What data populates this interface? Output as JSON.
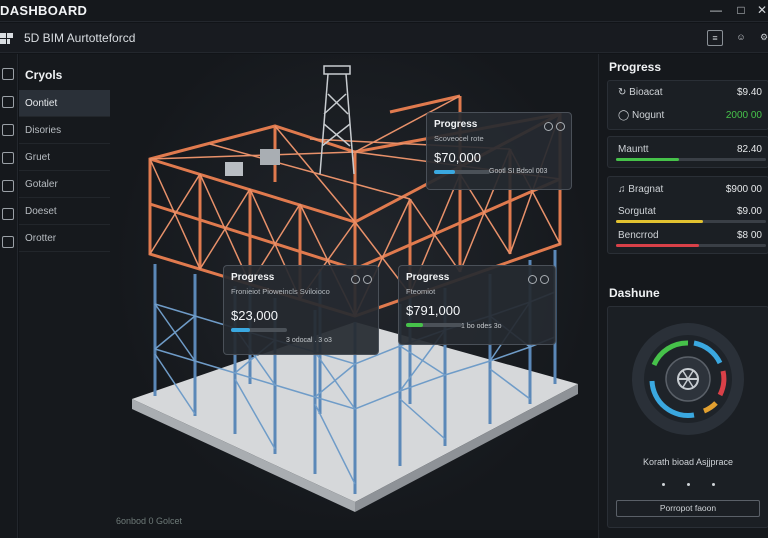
{
  "window": {
    "title": "DASHBOARD"
  },
  "app": {
    "title": "5D BIM Aurtotteforcd"
  },
  "sidebar": {
    "heading": "Cryols",
    "items": [
      {
        "label": "Oontiet",
        "active": true
      },
      {
        "label": "Disories"
      },
      {
        "label": "Gruet"
      },
      {
        "label": "Gotaler"
      },
      {
        "label": "Doeset"
      },
      {
        "label": "Orotter"
      }
    ]
  },
  "viewport": {
    "status": "6onbod 0 Golcet",
    "cards": [
      {
        "title": "Progress",
        "subtitle": "Scoveocel rote",
        "value": "$70,000",
        "progress": 0.38,
        "bar_color": "#3aa8e0",
        "bar_text": "Gootl   SI Bdsol 003"
      },
      {
        "title": "Progress",
        "subtitle": "Fronieiot  Pioweincls Sviloioco",
        "value": "$23,000",
        "progress": 0.34,
        "bar_color": "#3aa8e0",
        "bar_text": "3   odocal .   3 o3"
      },
      {
        "title": "Progress",
        "subtitle": "Fteomiot",
        "value": "$791,000",
        "progress": 0.3,
        "bar_color": "#46c24a",
        "bar_text": "1  bo  odes 3o"
      }
    ]
  },
  "progress_panel": {
    "heading": "Progress",
    "rows": [
      {
        "icon": "refresh-icon",
        "label": "Bioacat",
        "value": "$9.40"
      },
      {
        "icon": "chat-icon",
        "label": "Nogunt",
        "value": "2000 00",
        "value_color": "#46c24a"
      },
      {
        "label": "Mauntt",
        "value": "82.40",
        "progress": 0.42,
        "bar_color": "#46c24a"
      },
      {
        "icon": "music-icon",
        "label": "Bragnat",
        "value": "$900 00"
      },
      {
        "label": "Sorgutat",
        "value": "$9.00",
        "progress": 0.58,
        "bar_color": "#e2c230"
      },
      {
        "label": "Bencrrod",
        "value": "$8 00",
        "progress": 0.55,
        "bar_color": "#d94048"
      }
    ]
  },
  "dashboard": {
    "heading": "Dashune",
    "gauge_label": "Korath bioad Asjjprace",
    "button_label": "Porropot faoon"
  }
}
